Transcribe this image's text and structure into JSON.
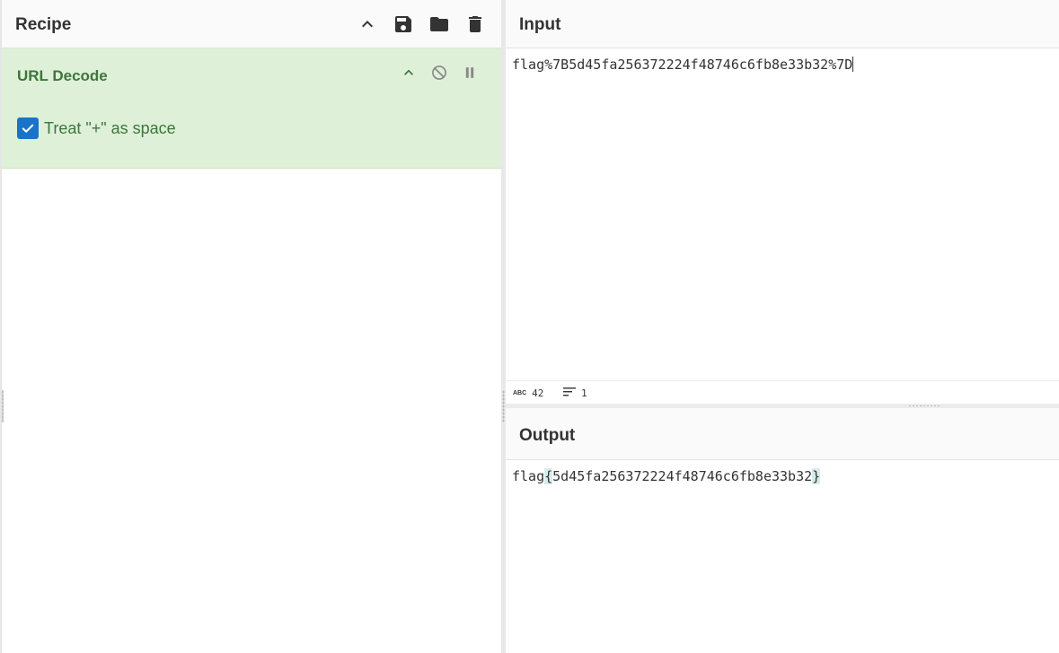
{
  "recipe": {
    "title": "Recipe",
    "controls": [
      "collapse-all",
      "save-recipe",
      "load-recipe",
      "clear-recipe"
    ]
  },
  "operation": {
    "name": "URL Decode",
    "option_label": "Treat \"+\" as space",
    "option_checked": true
  },
  "input": {
    "title": "Input",
    "text": "flag%7B5d45fa256372224f48746c6fb8e33b32%7D",
    "char_count": "42",
    "line_count": "1",
    "char_icon_text": "ABC"
  },
  "output": {
    "title": "Output",
    "prefix": "flag",
    "open_brace": "{",
    "body": "5d45fa256372224f48746c6fb8e33b32",
    "close_brace": "}"
  },
  "colors": {
    "operation_bg": "#dff0d8",
    "operation_text": "#3c763d",
    "checkbox": "#1a73c9",
    "brace_highlight": "#d7ecec"
  }
}
